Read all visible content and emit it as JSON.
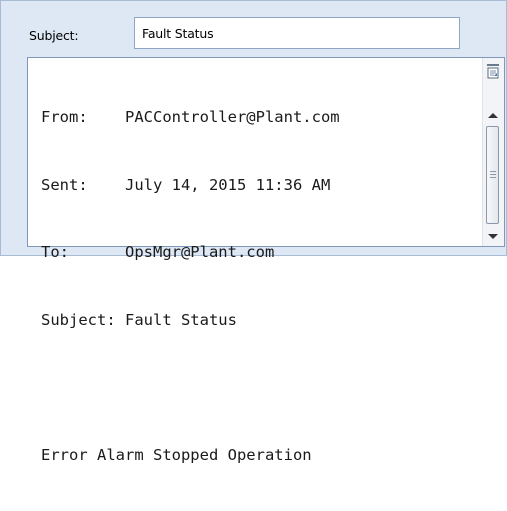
{
  "subject": {
    "label": "Subject:",
    "value": "Fault Status"
  },
  "message": {
    "lines": [
      "From:    PACController@Plant.com",
      "Sent:    July 14, 2015 11:36 AM",
      "To:      OpsMgr@Plant.com",
      "Subject: Fault Status",
      "",
      "Error Alarm Stopped Operation"
    ]
  },
  "scrollbar": {
    "top_icon": "page-split-icon",
    "up_icon": "arrow-up-icon",
    "down_icon": "arrow-down-icon"
  }
}
